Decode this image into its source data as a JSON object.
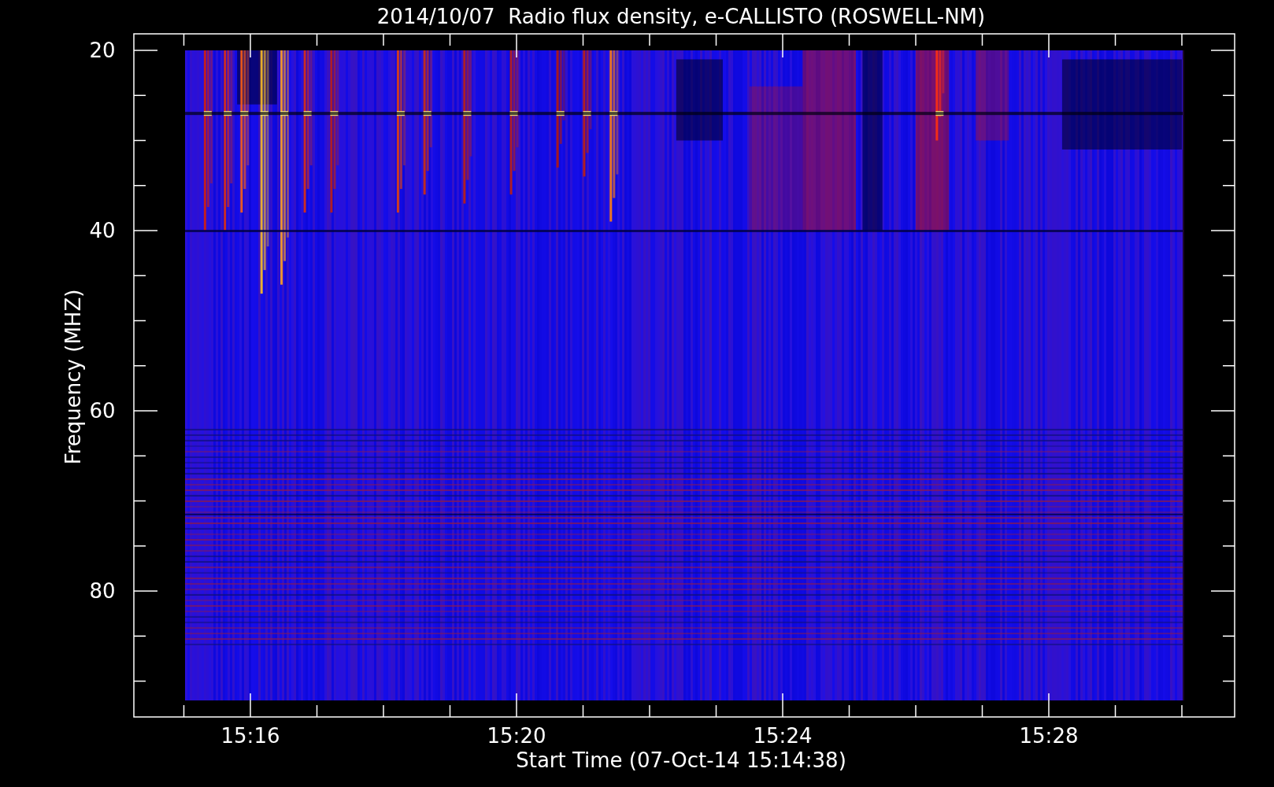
{
  "title": "2014/10/07  Radio flux density, e-CALLISTO (ROSWELL-NM)",
  "y_axis": {
    "label": "Frequency (MHZ)",
    "ticks": [
      "20",
      "40",
      "60",
      "80"
    ]
  },
  "x_axis": {
    "label": "Start Time (07-Oct-14 15:14:38)",
    "ticks": [
      "15:16",
      "15:20",
      "15:24",
      "15:28"
    ]
  }
}
